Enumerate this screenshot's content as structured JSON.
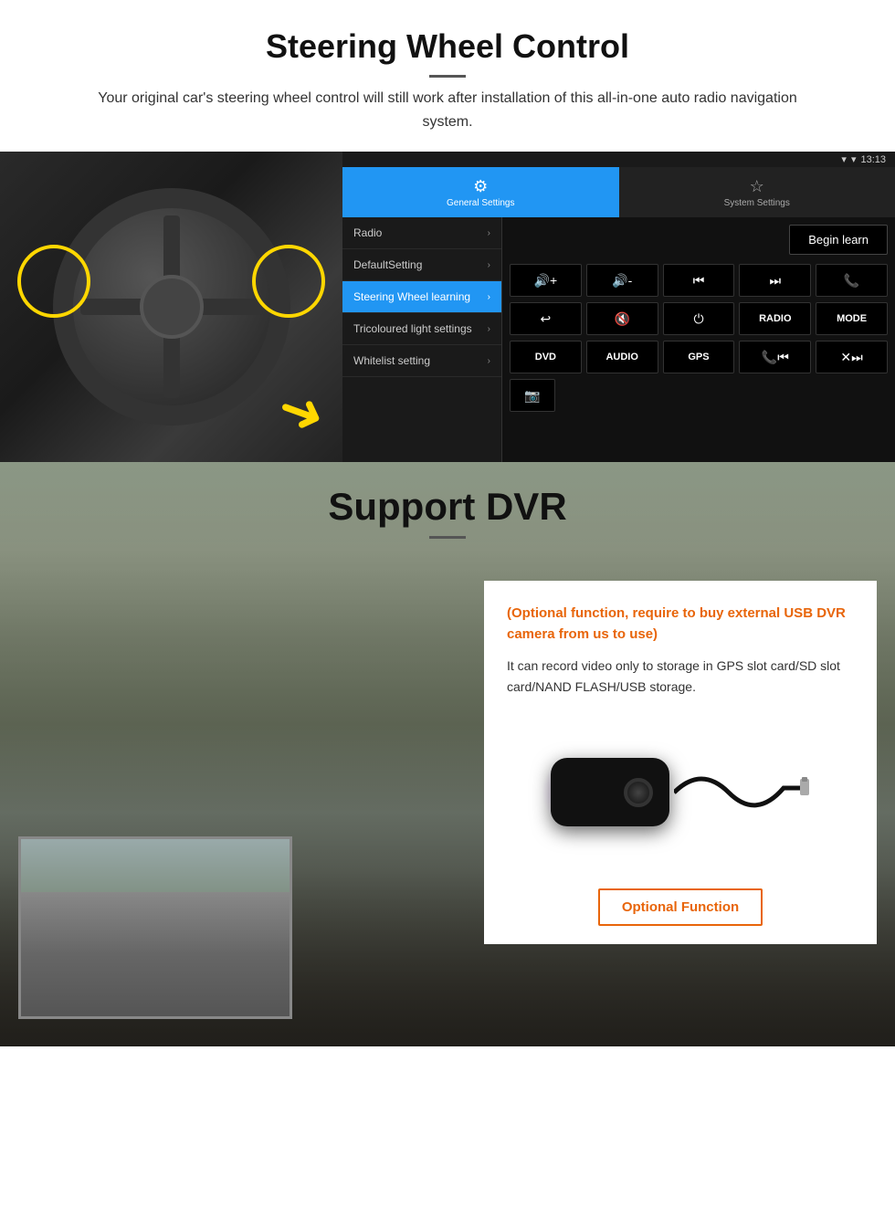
{
  "steering": {
    "title": "Steering Wheel Control",
    "description": "Your original car's steering wheel control will still work after installation of this all-in-one auto radio navigation system.",
    "statusbar": {
      "time": "13:13",
      "icons": "▾ ▾"
    },
    "tabs": {
      "general": {
        "icon": "⚙",
        "label": "General Settings"
      },
      "system": {
        "icon": "☆",
        "label": "System Settings"
      }
    },
    "menu": [
      {
        "label": "Radio",
        "active": false
      },
      {
        "label": "DefaultSetting",
        "active": false
      },
      {
        "label": "Steering Wheel learning",
        "active": true
      },
      {
        "label": "Tricoloured light settings",
        "active": false
      },
      {
        "label": "Whitelist setting",
        "active": false
      }
    ],
    "begin_learn_label": "Begin learn",
    "control_buttons": [
      [
        "🔊+",
        "🔊-",
        "⏮",
        "⏭",
        "📞"
      ],
      [
        "↩",
        "🔊✕",
        "⏻",
        "RADIO",
        "MODE"
      ],
      [
        "DVD",
        "AUDIO",
        "GPS",
        "📞⏮",
        "✕⏭"
      ],
      [
        "📷"
      ]
    ]
  },
  "dvr": {
    "title": "Support DVR",
    "optional_text": "(Optional function, require to buy external USB DVR camera from us to use)",
    "description": "It can record video only to storage in GPS slot card/SD slot card/NAND FLASH/USB storage.",
    "optional_function_btn": "Optional Function"
  }
}
